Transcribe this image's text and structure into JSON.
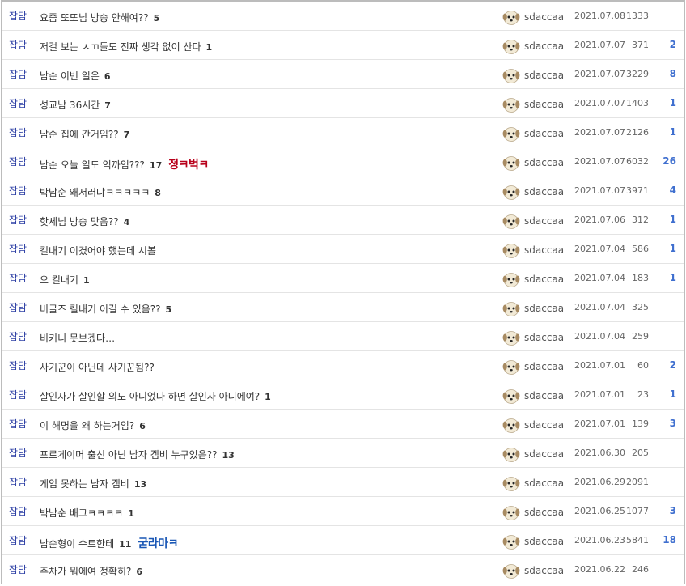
{
  "board": {
    "rows": [
      {
        "category": "잡담",
        "title": "요즘 또또님 방송 안해여??",
        "comments": "5",
        "badge": "",
        "badge_color": "",
        "author": "sdaccaa",
        "date": "2021.07.08",
        "views": "1333",
        "likes": ""
      },
      {
        "category": "잡담",
        "title": "저걸 보는 ㅅㄲ들도 진짜 생각 없이 산다",
        "comments": "1",
        "badge": "",
        "badge_color": "",
        "author": "sdaccaa",
        "date": "2021.07.07",
        "views": "371",
        "likes": "2"
      },
      {
        "category": "잡담",
        "title": "남순 이번 일은",
        "comments": "6",
        "badge": "",
        "badge_color": "",
        "author": "sdaccaa",
        "date": "2021.07.07",
        "views": "3229",
        "likes": "8"
      },
      {
        "category": "잡담",
        "title": "성교남 36시간",
        "comments": "7",
        "badge": "",
        "badge_color": "",
        "author": "sdaccaa",
        "date": "2021.07.07",
        "views": "1403",
        "likes": "1"
      },
      {
        "category": "잡담",
        "title": "남순 집에 간거임??",
        "comments": "7",
        "badge": "",
        "badge_color": "",
        "author": "sdaccaa",
        "date": "2021.07.07",
        "views": "2126",
        "likes": "1"
      },
      {
        "category": "잡담",
        "title": "남순 오늘 일도 억까임???",
        "comments": "17",
        "badge": "정ㅋ벅ㅋ",
        "badge_color": "red",
        "author": "sdaccaa",
        "date": "2021.07.07",
        "views": "6032",
        "likes": "26"
      },
      {
        "category": "잡담",
        "title": "박남순 왜저러냐ㅋㅋㅋㅋㅋ",
        "comments": "8",
        "badge": "",
        "badge_color": "",
        "author": "sdaccaa",
        "date": "2021.07.07",
        "views": "3971",
        "likes": "4"
      },
      {
        "category": "잡담",
        "title": "핫세님 방송 맞음??",
        "comments": "4",
        "badge": "",
        "badge_color": "",
        "author": "sdaccaa",
        "date": "2021.07.06",
        "views": "312",
        "likes": "1"
      },
      {
        "category": "잡담",
        "title": "킬내기 이겼어야 했는데 시볼",
        "comments": "",
        "badge": "",
        "badge_color": "",
        "author": "sdaccaa",
        "date": "2021.07.04",
        "views": "586",
        "likes": "1"
      },
      {
        "category": "잡담",
        "title": "오 킬내기",
        "comments": "1",
        "badge": "",
        "badge_color": "",
        "author": "sdaccaa",
        "date": "2021.07.04",
        "views": "183",
        "likes": "1"
      },
      {
        "category": "잡담",
        "title": "비글즈 킬내기 이길 수 있음??",
        "comments": "5",
        "badge": "",
        "badge_color": "",
        "author": "sdaccaa",
        "date": "2021.07.04",
        "views": "325",
        "likes": ""
      },
      {
        "category": "잡담",
        "title": "비키니 못보겠다…",
        "comments": "",
        "badge": "",
        "badge_color": "",
        "author": "sdaccaa",
        "date": "2021.07.04",
        "views": "259",
        "likes": ""
      },
      {
        "category": "잡담",
        "title": "사기꾼이 아닌데 사기꾼됨??",
        "comments": "",
        "badge": "",
        "badge_color": "",
        "author": "sdaccaa",
        "date": "2021.07.01",
        "views": "60",
        "likes": "2"
      },
      {
        "category": "잡담",
        "title": "살인자가 살인할 의도 아니었다 하면 살인자 아니에여?",
        "comments": "1",
        "badge": "",
        "badge_color": "",
        "author": "sdaccaa",
        "date": "2021.07.01",
        "views": "23",
        "likes": "1"
      },
      {
        "category": "잡담",
        "title": "이 해명을 왜 하는거임?",
        "comments": "6",
        "badge": "",
        "badge_color": "",
        "author": "sdaccaa",
        "date": "2021.07.01",
        "views": "139",
        "likes": "3"
      },
      {
        "category": "잡담",
        "title": "프로게이머 출신 아닌 남자 겜비 누구있음??",
        "comments": "13",
        "badge": "",
        "badge_color": "",
        "author": "sdaccaa",
        "date": "2021.06.30",
        "views": "205",
        "likes": ""
      },
      {
        "category": "잡담",
        "title": "게임 못하는 남자 겜비",
        "comments": "13",
        "badge": "",
        "badge_color": "",
        "author": "sdaccaa",
        "date": "2021.06.29",
        "views": "2091",
        "likes": ""
      },
      {
        "category": "잡담",
        "title": "박남순 배그ㅋㅋㅋㅋ",
        "comments": "1",
        "badge": "",
        "badge_color": "",
        "author": "sdaccaa",
        "date": "2021.06.25",
        "views": "1077",
        "likes": "3"
      },
      {
        "category": "잡담",
        "title": "남순형이 수트한테",
        "comments": "11",
        "badge": "굳라마ㅋ",
        "badge_color": "blue",
        "author": "sdaccaa",
        "date": "2021.06.23",
        "views": "5841",
        "likes": "18"
      },
      {
        "category": "잡담",
        "title": "주차가 뭐에여 정확히?",
        "comments": "6",
        "badge": "",
        "badge_color": "",
        "author": "sdaccaa",
        "date": "2021.06.22",
        "views": "246",
        "likes": ""
      }
    ]
  },
  "icons": {
    "avatar": "dog-avatar-icon"
  }
}
